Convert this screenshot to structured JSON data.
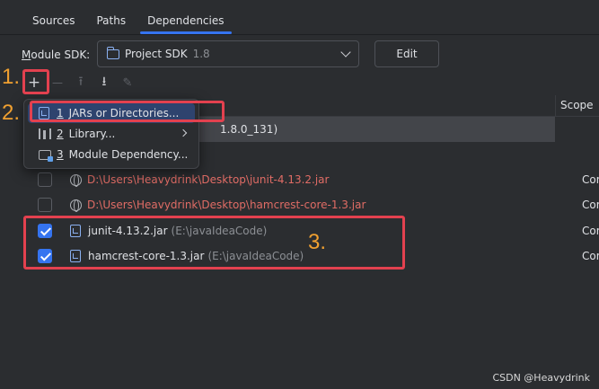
{
  "tabs": [
    {
      "label": "Sources",
      "active": false
    },
    {
      "label": "Paths",
      "active": false
    },
    {
      "label": "Dependencies",
      "active": true
    }
  ],
  "sdk": {
    "label_prefix": "M",
    "label_rest": "odule SDK:",
    "selected": "Project SDK",
    "version": "1.8",
    "edit_label": "Edit"
  },
  "toolbar": {
    "add": "+",
    "remove": "—",
    "up": "⭱",
    "down": "⭳",
    "edit": "✎"
  },
  "table": {
    "scope_header": "Scope",
    "jdk_suffix": "1.8.0_131)",
    "rows": [
      {
        "checked": false,
        "path": "D:\\Users\\Heavydrink\\Desktop\\junit-4.13.2.jar",
        "scope": "Compile"
      },
      {
        "checked": false,
        "path": "D:\\Users\\Heavydrink\\Desktop\\hamcrest-core-1.3.jar",
        "scope": "Compile"
      },
      {
        "checked": true,
        "name": "junit-4.13.2.jar",
        "location": "(E:\\javaIdeaCode)",
        "scope": "Compile"
      },
      {
        "checked": true,
        "name": "hamcrest-core-1.3.jar",
        "location": "(E:\\javaIdeaCode)",
        "scope": "Compile"
      }
    ]
  },
  "popup": {
    "items": [
      {
        "num": "1",
        "label": "JARs or Directories..."
      },
      {
        "num": "2",
        "label": "Library..."
      },
      {
        "num": "3",
        "label": "Module Dependency..."
      }
    ]
  },
  "annotations": {
    "step1": "1.",
    "step2": "2.",
    "step3": "3."
  },
  "watermark": "CSDN @Heavydrink",
  "colors": {
    "accent": "#3574f0",
    "annotation_red": "#e3414f",
    "annotation_orange": "#f0a030",
    "error_path": "#e06c65"
  }
}
